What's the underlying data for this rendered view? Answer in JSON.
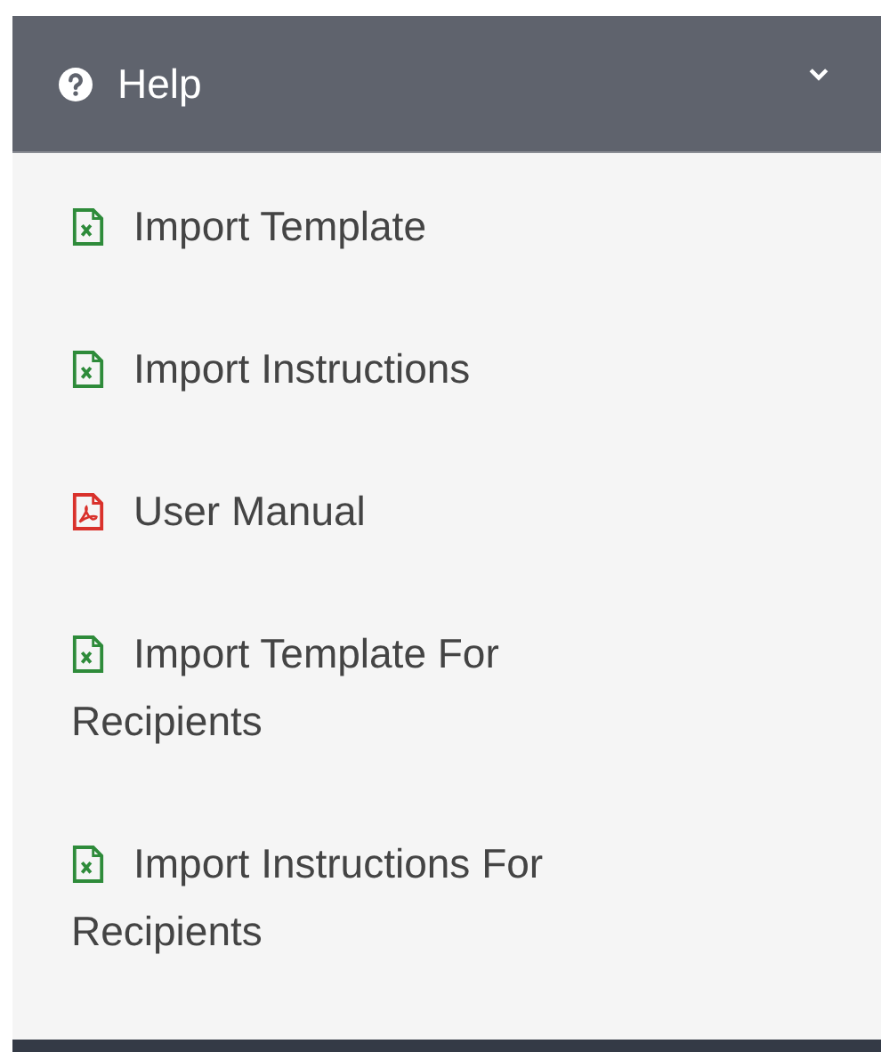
{
  "panel": {
    "title": "Help",
    "expanded": true
  },
  "items": [
    {
      "label": "Import Template",
      "kind": "excel"
    },
    {
      "label": "Import Instructions",
      "kind": "excel"
    },
    {
      "label": "User Manual",
      "kind": "pdf"
    },
    {
      "label": "Import Template For Recipients",
      "kind": "excel"
    },
    {
      "label": "Import Instructions For Recipients",
      "kind": "excel"
    }
  ]
}
